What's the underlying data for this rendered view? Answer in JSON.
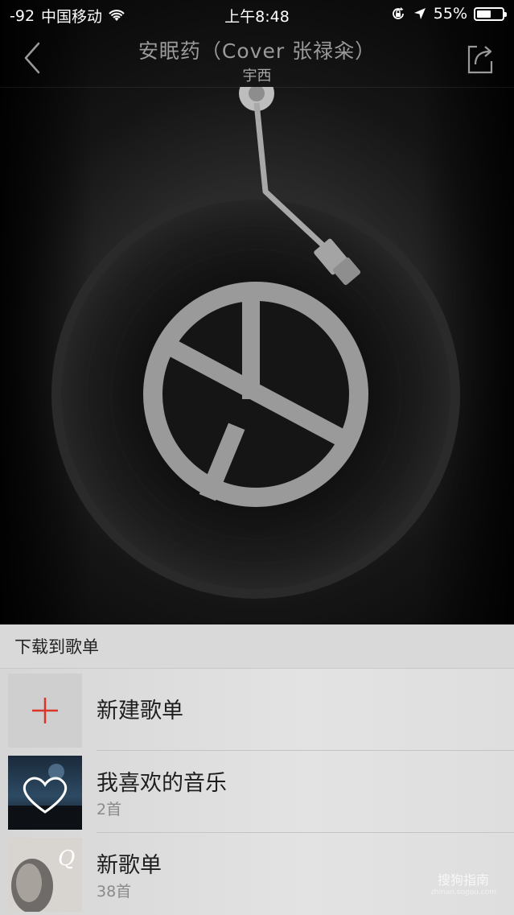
{
  "status_bar": {
    "signal": "-92",
    "carrier": "中国移动",
    "time": "上午8:48",
    "battery": "55%",
    "battery_level": 0.55
  },
  "player": {
    "title": "安眠药（Cover  张禄籴）",
    "artist": "宇西",
    "back_icon": "chevron-left-icon",
    "share_icon": "share-icon"
  },
  "sheet": {
    "header": "下载到歌单",
    "items": [
      {
        "name": "新建歌单",
        "count": "",
        "icon": "plus-icon"
      },
      {
        "name": "我喜欢的音乐",
        "count": "2首",
        "icon": "heart-icon"
      },
      {
        "name": "新歌单",
        "count": "38首",
        "icon": "album-cover"
      }
    ]
  },
  "watermark": {
    "text": "搜狗指南",
    "sub": "zhinan.sogou.com"
  },
  "colors": {
    "accent_red": "#d9352b",
    "sheet_bg": "#dcdcdc"
  }
}
